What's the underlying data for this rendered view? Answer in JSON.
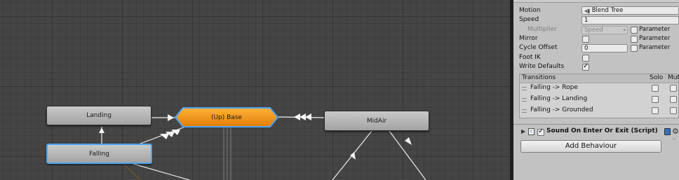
{
  "graph": {
    "states": {
      "landing": "Landing",
      "falling": "Falling",
      "base": "(Up) Base",
      "midair": "MidAir"
    }
  },
  "inspector": {
    "motion": {
      "label": "Motion",
      "value": "Blend Tree"
    },
    "speed": {
      "label": "Speed",
      "value": "1"
    },
    "multiplier": {
      "label": "Multiplier",
      "value": "Speed",
      "param_label": "Parameter"
    },
    "mirror": {
      "label": "Mirror",
      "param_label": "Parameter"
    },
    "cycle_offset": {
      "label": "Cycle Offset",
      "value": "0",
      "param_label": "Parameter"
    },
    "foot_ik": {
      "label": "Foot IK"
    },
    "write_defaults": {
      "label": "Write Defaults",
      "checked": true
    },
    "transitions": {
      "header": "Transitions",
      "solo_label": "Solo",
      "mute_label": "Mute",
      "items": [
        "Falling -> Rope",
        "Falling -> Landing",
        "Falling -> Grounded"
      ]
    },
    "component": {
      "title": "Sound On Enter Or Exit (Script)",
      "enabled": true
    },
    "add_behaviour_label": "Add Behaviour"
  },
  "colors": {
    "graph_background": "#454545",
    "state_node": "#b8b8b8",
    "default_state": "#f08d0c",
    "selection_outline": "#4ba3f2",
    "inspector_background": "#c2c2c2"
  }
}
